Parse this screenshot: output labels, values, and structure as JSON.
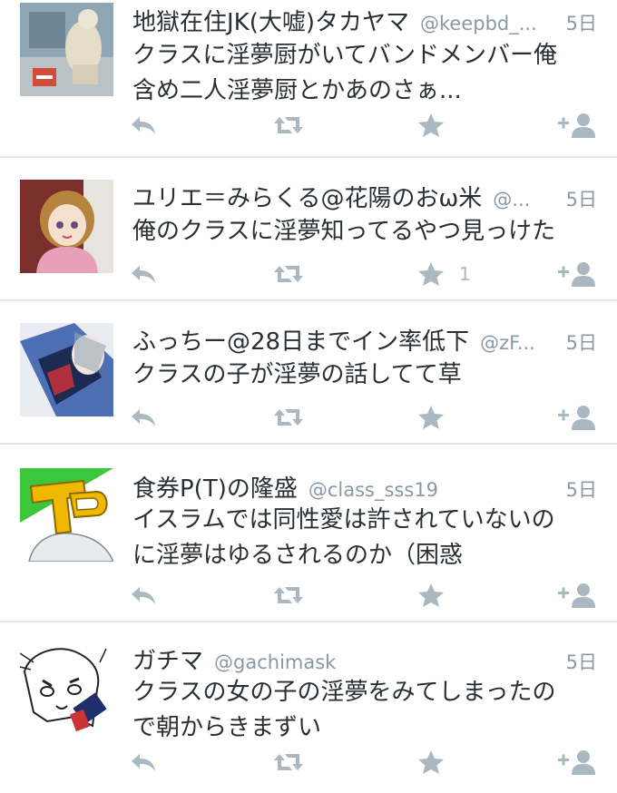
{
  "colors": {
    "name": "#292f33",
    "secondary": "#8899a6",
    "icon": "#aab8c2",
    "divider": "#e1e8ed"
  },
  "tweets": [
    {
      "name": "地獄在住JK(大嘘)タカヤマ",
      "handle": "@keepbd_...",
      "time": "5日",
      "text": "クラスに淫夢厨がいてバンドメンバー俺\n含め二人淫夢厨とかあのさぁ...",
      "fav_count": ""
    },
    {
      "name": "ユリエ＝みらくる@花陽のおω米",
      "handle": "@...",
      "time": "5日",
      "text": "俺のクラスに淫夢知ってるやつ見っけた",
      "fav_count": "1"
    },
    {
      "name": "ふっちー@28日までイン率低下",
      "handle": "@zF...",
      "time": "5日",
      "text": "クラスの子が淫夢の話してて草",
      "fav_count": ""
    },
    {
      "name": "食券P(T)の隆盛",
      "handle": "@class_sss19",
      "time": "5日",
      "text": "イスラムでは同性愛は許されていないの\nに淫夢はゆるされるのか（困惑",
      "fav_count": ""
    },
    {
      "name": "ガチマ",
      "handle": "@gachimask",
      "time": "5日",
      "text": "クラスの女の子の淫夢をみてしまったの\nで朝からきまずい",
      "fav_count": ""
    }
  ],
  "icons": {
    "reply": "reply-icon",
    "retweet": "retweet-icon",
    "favorite": "star-icon",
    "follow": "follow-icon"
  }
}
